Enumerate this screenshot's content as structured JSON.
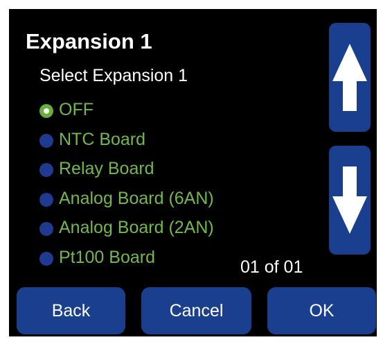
{
  "header": {
    "title": "Expansion 1",
    "subtitle": "Select Expansion 1"
  },
  "options": [
    {
      "label": "OFF",
      "selected": true
    },
    {
      "label": "NTC Board",
      "selected": false
    },
    {
      "label": "Relay Board",
      "selected": false
    },
    {
      "label": "Analog Board (6AN)",
      "selected": false
    },
    {
      "label": "Analog Board (2AN)",
      "selected": false
    },
    {
      "label": "Pt100 Board",
      "selected": false
    }
  ],
  "pagination": {
    "text": "01 of 01"
  },
  "scroll": {
    "up_icon": "arrow-up-icon",
    "down_icon": "arrow-down-icon"
  },
  "actions": {
    "back_label": "Back",
    "cancel_label": "Cancel",
    "ok_label": "OK"
  },
  "colors": {
    "background": "#000000",
    "button": "#1b3f8f",
    "option_text": "#72b94a",
    "radio_selected": "#69ad3b",
    "radio_unselected": "#1f3a91",
    "text": "#ffffff"
  }
}
